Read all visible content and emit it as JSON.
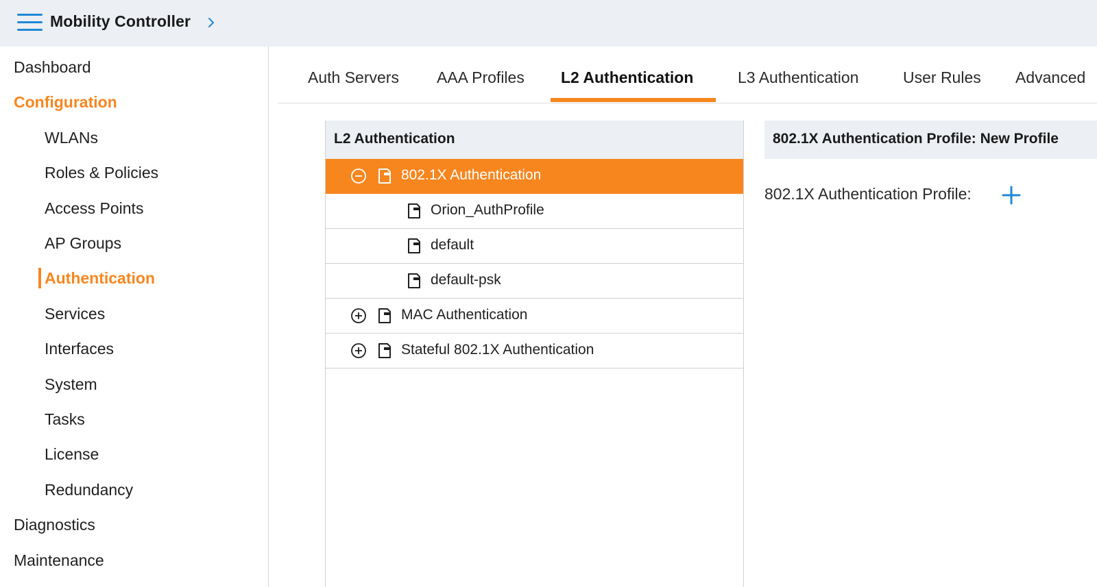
{
  "header": {
    "title": "Mobility Controller",
    "menu_icon": "hamburger-menu-icon",
    "chevron_icon": "chevron-right-icon"
  },
  "sidebar": {
    "items": [
      {
        "label": "Dashboard",
        "level": "top",
        "state": "normal"
      },
      {
        "label": "Configuration",
        "level": "top",
        "state": "expanded"
      },
      {
        "label": "WLANs",
        "level": "sub",
        "state": "normal"
      },
      {
        "label": "Roles & Policies",
        "level": "sub",
        "state": "normal"
      },
      {
        "label": "Access Points",
        "level": "sub",
        "state": "normal"
      },
      {
        "label": "AP Groups",
        "level": "sub",
        "state": "normal"
      },
      {
        "label": "Authentication",
        "level": "sub",
        "state": "active"
      },
      {
        "label": "Services",
        "level": "sub",
        "state": "normal"
      },
      {
        "label": "Interfaces",
        "level": "sub",
        "state": "normal"
      },
      {
        "label": "System",
        "level": "sub",
        "state": "normal"
      },
      {
        "label": "Tasks",
        "level": "sub",
        "state": "normal"
      },
      {
        "label": "License",
        "level": "sub",
        "state": "normal"
      },
      {
        "label": "Redundancy",
        "level": "sub",
        "state": "normal"
      },
      {
        "label": "Diagnostics",
        "level": "top",
        "state": "normal"
      },
      {
        "label": "Maintenance",
        "level": "top",
        "state": "normal"
      }
    ]
  },
  "tabs": [
    {
      "label": "Auth Servers",
      "active": false
    },
    {
      "label": "AAA Profiles",
      "active": false
    },
    {
      "label": "L2 Authentication",
      "active": true
    },
    {
      "label": "L3 Authentication",
      "active": false
    },
    {
      "label": "User Rules",
      "active": false
    },
    {
      "label": "Advanced",
      "active": false
    }
  ],
  "tree": {
    "title": "L2 Authentication",
    "rows": [
      {
        "label": "802.1X Authentication",
        "toggle": "collapse-icon",
        "icon": "document-icon",
        "depth": 0,
        "selected": true
      },
      {
        "label": "Orion_AuthProfile",
        "toggle": null,
        "icon": "document-icon",
        "depth": 1,
        "selected": false
      },
      {
        "label": "default",
        "toggle": null,
        "icon": "document-icon",
        "depth": 1,
        "selected": false
      },
      {
        "label": "default-psk",
        "toggle": null,
        "icon": "document-icon",
        "depth": 1,
        "selected": false
      },
      {
        "label": "MAC Authentication",
        "toggle": "expand-icon",
        "icon": "document-icon",
        "depth": 0,
        "selected": false
      },
      {
        "label": "Stateful 802.1X Authentication",
        "toggle": "expand-icon",
        "icon": "document-icon",
        "depth": 0,
        "selected": false
      }
    ]
  },
  "detail": {
    "title": "802.1X Authentication Profile: New Profile",
    "field_label": "802.1X Authentication Profile:",
    "add_icon": "plus-icon"
  },
  "colors": {
    "accent": "#f7861f",
    "brand_blue": "#1e88d6",
    "header_bg": "#eceff3"
  }
}
